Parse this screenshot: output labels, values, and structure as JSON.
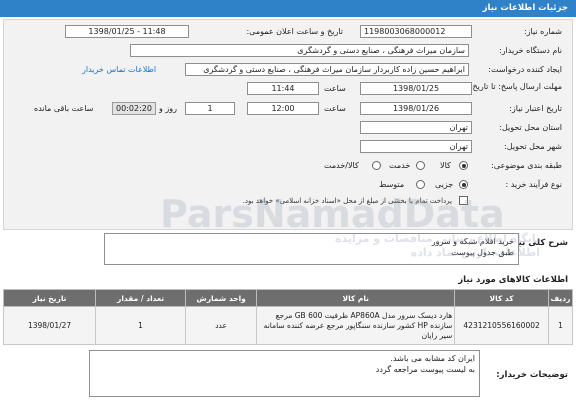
{
  "header": {
    "title": "جزئيات اطلاعات نیاز"
  },
  "form": {
    "need_number": {
      "label": "شماره نیاز:",
      "value": "1198003068000012"
    },
    "announce": {
      "label": "تاریخ و ساعت اعلان عمومی:",
      "value": "1398/01/25 - 11:48"
    },
    "buyer_org": {
      "label": "نام دستگاه خریدار:",
      "value": "سازمان میراث فرهنگی ، صنایع دستی و گردشگری"
    },
    "creator": {
      "label": "ایجاد کننده درخواست:",
      "value": "ابراهیم حسین زاده کاربردار سازمان میراث فرهنگی ، صنایع دستی و گردشگری",
      "contact_link": "اطلاعات تماس خریدار"
    },
    "reply_deadline": {
      "label": "مهلت ارسال پاسخ: تا تاریخ:",
      "date": "1398/01/25",
      "time_label": "ساعت",
      "time": "11:44"
    },
    "validity": {
      "label": "تاریخ اعتبار نیاز:",
      "date": "1398/01/26",
      "time_label": "ساعت",
      "time": "12:00",
      "days": "1",
      "days_label": "روز و",
      "remaining": "00:02:20",
      "remaining_label": "ساعت باقی مانده"
    },
    "province": {
      "label": "استان محل تحویل:",
      "value": "تهران"
    },
    "city": {
      "label": "شهر محل تحویل:",
      "value": "تهران"
    },
    "category": {
      "label": "طبقه بندی موضوعی:",
      "options": [
        "کالا",
        "خدمت",
        "کالا/خدمت"
      ],
      "selected": "کالا"
    },
    "process": {
      "label": "نوع فرآیند خرید :",
      "options": [
        "جزیی",
        "متوسط"
      ],
      "selected": "جزیی",
      "note": "پرداخت تمام یا بخشی از مبلغ از محل «اسناد خزانه اسلامی» خواهد بود."
    }
  },
  "summary": {
    "label": "شرح کلی نیاز:",
    "lines": [
      "خرید اقلام شبکه و سرور",
      "طبق جدول پیوست"
    ]
  },
  "goods": {
    "title": "اطلاعات کالاهای مورد نیاز",
    "columns": [
      "ردیف",
      "کد کالا",
      "نام کالا",
      "واحد شمارش",
      "تعداد / مقدار",
      "تاریخ نیاز"
    ],
    "rows": [
      {
        "index": "1",
        "code": "4231210556160002",
        "name": "هارد دیسک سرور مدل AP860A ظرفیت 600 GB مرجع سازنده HP کشور سازنده سنگاپور مرجع عرضه کننده سامانه سیر رایان",
        "unit": "عدد",
        "qty": "1",
        "date": "1398/01/27"
      }
    ]
  },
  "buyer_notes": {
    "label": "توضیحات خریدار:",
    "lines": [
      "ایران کد مشابه می باشد.",
      "به لیست پیوست مراجعه گردد"
    ]
  },
  "watermark": {
    "text": "ParsNamadData",
    "lines": [
      "پایگاه اطلاع رسانی مناقصات و مزایده",
      "اطلاعات پارس نماد داده"
    ]
  }
}
